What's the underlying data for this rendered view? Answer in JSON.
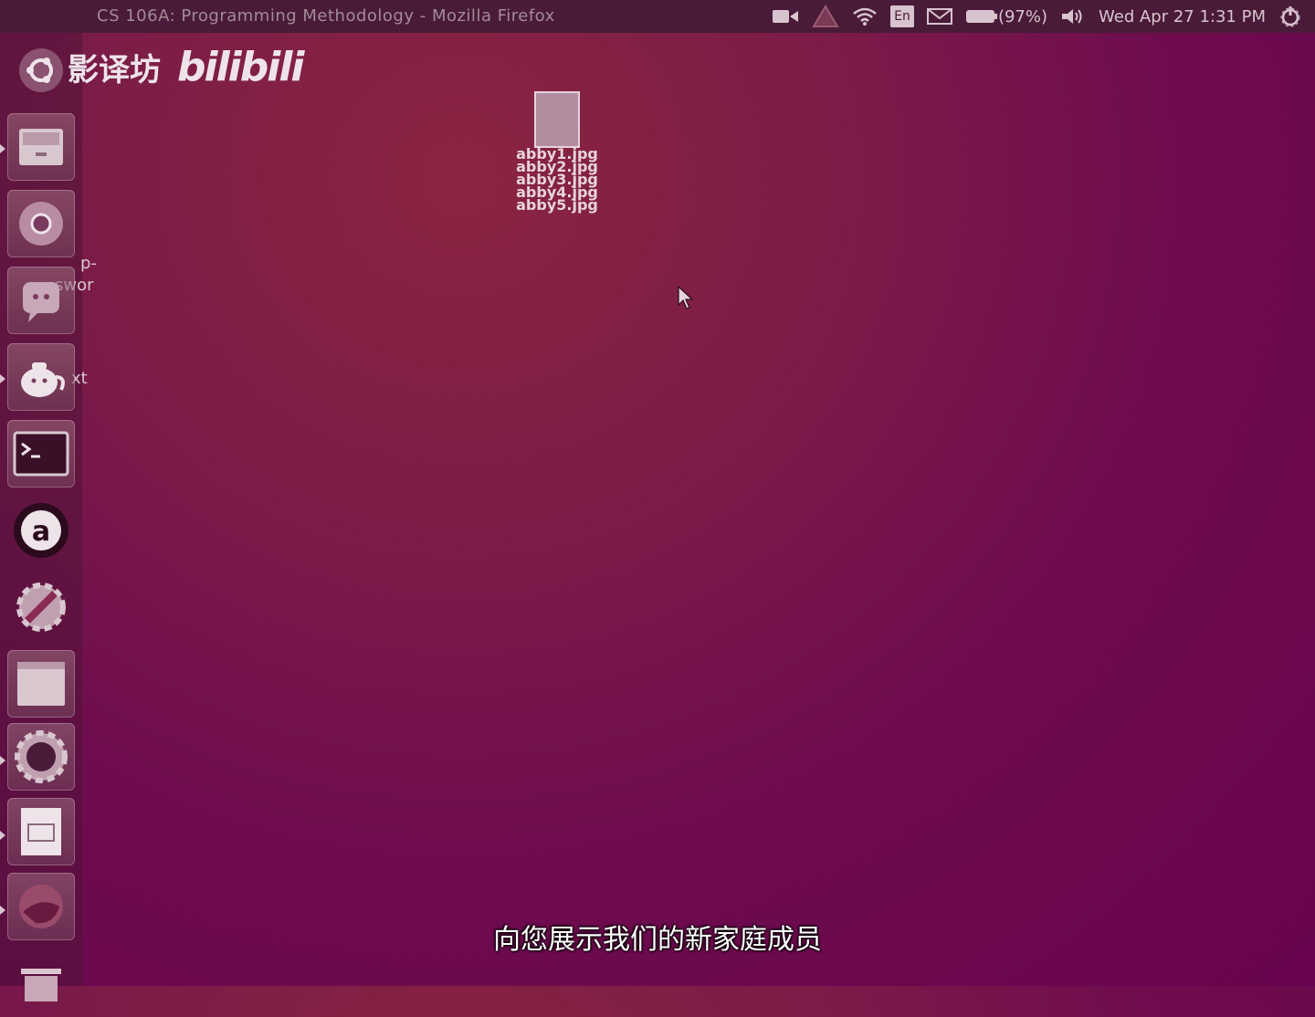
{
  "window_title": "CS 106A: Programming Methodology - Mozilla Firefox",
  "indicators": {
    "language": "En",
    "battery": "(97%)",
    "clock": "Wed Apr 27  1:31 PM"
  },
  "watermark": {
    "studio": "影译坊",
    "brand": "bilibili"
  },
  "launcher": {
    "fragment_1": "p-",
    "fragment_2": "swor",
    "fragment_3": "xt",
    "items": [
      {
        "name": "ubuntu-dash",
        "icon": "ubuntu-logo"
      },
      {
        "name": "files",
        "icon": "file-cabinet-icon"
      },
      {
        "name": "chrome",
        "icon": "chrome-icon"
      },
      {
        "name": "pidgin",
        "icon": "chat-icon"
      },
      {
        "name": "gedit",
        "icon": "teapot-icon"
      },
      {
        "name": "terminal",
        "icon": "terminal-icon"
      },
      {
        "name": "amazon",
        "icon": "amazon-icon"
      },
      {
        "name": "system-settings",
        "icon": "settings-icon"
      },
      {
        "name": "blank-app",
        "icon": "window-icon"
      },
      {
        "name": "eclipse-ide",
        "icon": "gear-ide-icon"
      },
      {
        "name": "presentation",
        "icon": "slides-icon"
      },
      {
        "name": "firefox",
        "icon": "firefox-icon"
      },
      {
        "name": "trash",
        "icon": "trash-icon"
      }
    ]
  },
  "desktop": {
    "file_labels": [
      "abby1.jpg",
      "abby2.jpg",
      "abby3.jpg",
      "abby4.jpg",
      "abby5.jpg"
    ]
  },
  "subtitle": "向您展示我们的新家庭成员"
}
